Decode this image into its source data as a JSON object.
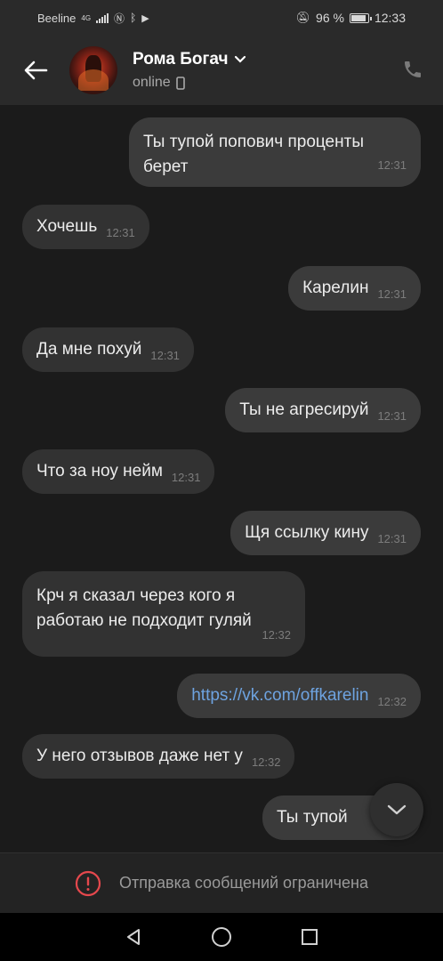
{
  "statusbar": {
    "carrier": "Beeline",
    "network": "4G",
    "battery_text": "96 %",
    "battery_level": 0.96,
    "time": "12:33"
  },
  "header": {
    "contact_name": "Рома Богач",
    "status": "online"
  },
  "messages": [
    {
      "dir": "out",
      "text": "Ты тупой попович проценты берет",
      "time": "12:31"
    },
    {
      "dir": "in",
      "text": "Хочешь",
      "time": "12:31"
    },
    {
      "dir": "out",
      "text": "Карелин",
      "time": "12:31"
    },
    {
      "dir": "in",
      "text": "Да мне похуй",
      "time": "12:31"
    },
    {
      "dir": "out",
      "text": "Ты не агресируй",
      "time": "12:31"
    },
    {
      "dir": "in",
      "text": "Что за ноу нейм",
      "time": "12:31"
    },
    {
      "dir": "out",
      "text": "Щя ссылку кину",
      "time": "12:31"
    },
    {
      "dir": "in",
      "text": "Крч я сказал через кого я работаю не подходит гуляй",
      "time": "12:32"
    },
    {
      "dir": "out",
      "text": "https://vk.com/offkarelin",
      "time": "12:32"
    },
    {
      "dir": "in",
      "text": "У него отзывов даже нет у",
      "time": "12:32"
    },
    {
      "dir": "out",
      "text": "Ты тупой",
      "time": ""
    }
  ],
  "restriction": {
    "text": "Отправка сообщений ограничена"
  },
  "icons": {
    "back": "arrow-left-icon",
    "phone": "phone-icon",
    "scroll": "chevron-down-icon",
    "warning": "alert-circle-icon"
  },
  "colors": {
    "background": "#1b1b1b",
    "header": "#2a2a2a",
    "bubble_in": "#323232",
    "bubble_out": "#3b3b3b",
    "link": "#6ea3e0"
  }
}
